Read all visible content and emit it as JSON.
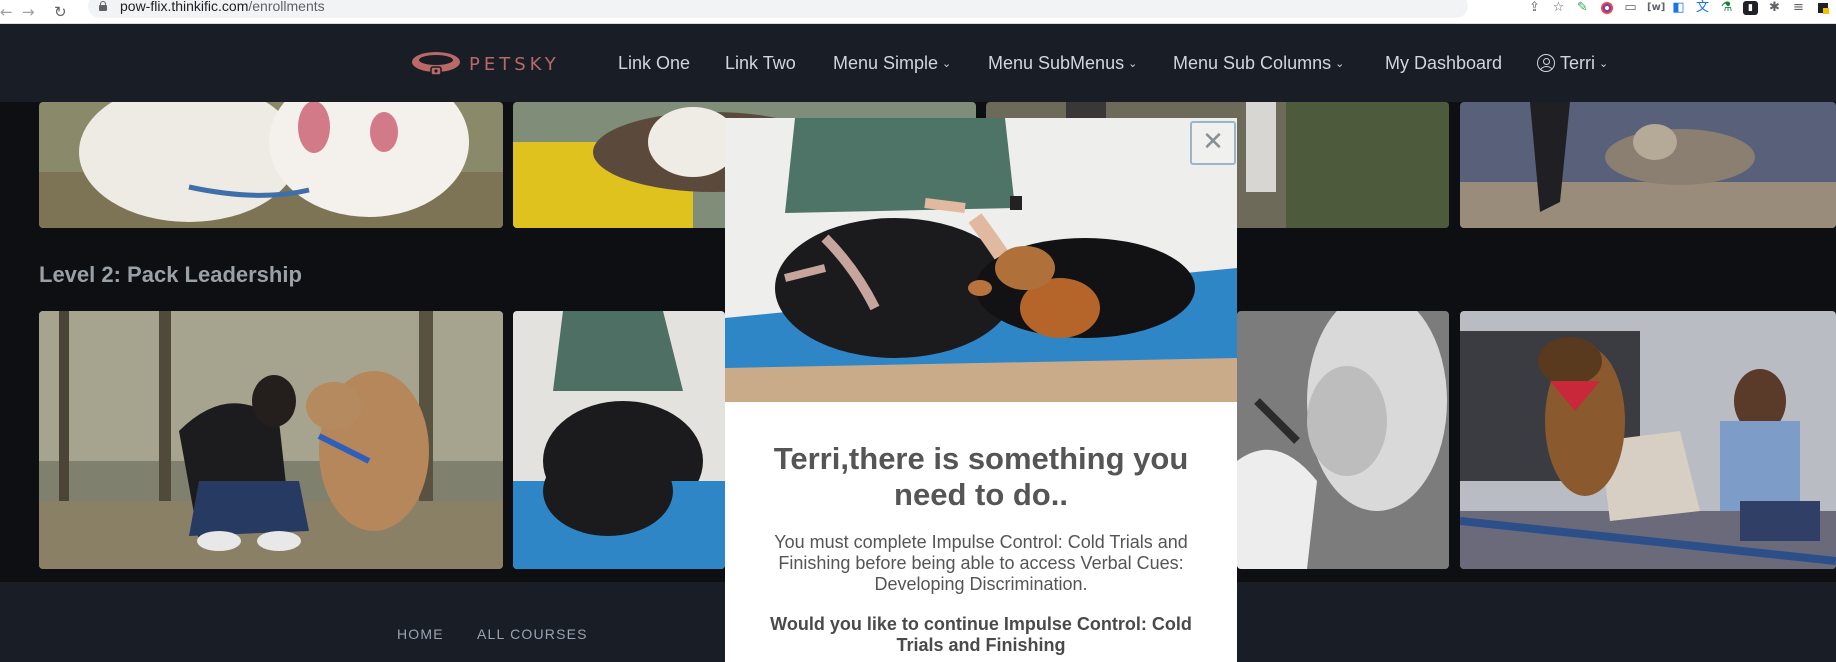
{
  "browser": {
    "url_host": "pow-flix.thinkific.com",
    "url_path": "/enrollments",
    "back_icon": "arrow-left-icon",
    "forward_icon": "arrow-right-icon",
    "reload_icon": "reload-icon",
    "reload_glyph": "↻",
    "back_glyph": "←",
    "forward_glyph": "→"
  },
  "header": {
    "logo_text": "PETSKY",
    "nav": [
      {
        "label": "Link One"
      },
      {
        "label": "Link Two"
      },
      {
        "label": "Menu Simple"
      },
      {
        "label": "Menu SubMenus"
      },
      {
        "label": "Menu Sub Columns"
      },
      {
        "label": "My Dashboard"
      },
      {
        "label": "Terri"
      }
    ],
    "chevron_glyph": "⌄"
  },
  "main": {
    "section_title": "Level 2: Pack Leadership"
  },
  "footer": {
    "links": [
      "HOME",
      "ALL COURSES"
    ]
  },
  "modal": {
    "close_glyph": "✕",
    "title": "Terri,there is something you need to do..",
    "body": "You must complete Impulse Control: Cold Trials and Finishing before being able to access Verbal Cues: Developing Discrimination.",
    "question": "Would you like to continue Impulse Control: Cold Trials and Finishing"
  },
  "colors": {
    "header_bg": "#181d26",
    "page_bg": "#0d0f12",
    "logo_accent": "#b96a66",
    "modal_bg": "#ffffff",
    "mat_blue": "#2f86c6"
  }
}
